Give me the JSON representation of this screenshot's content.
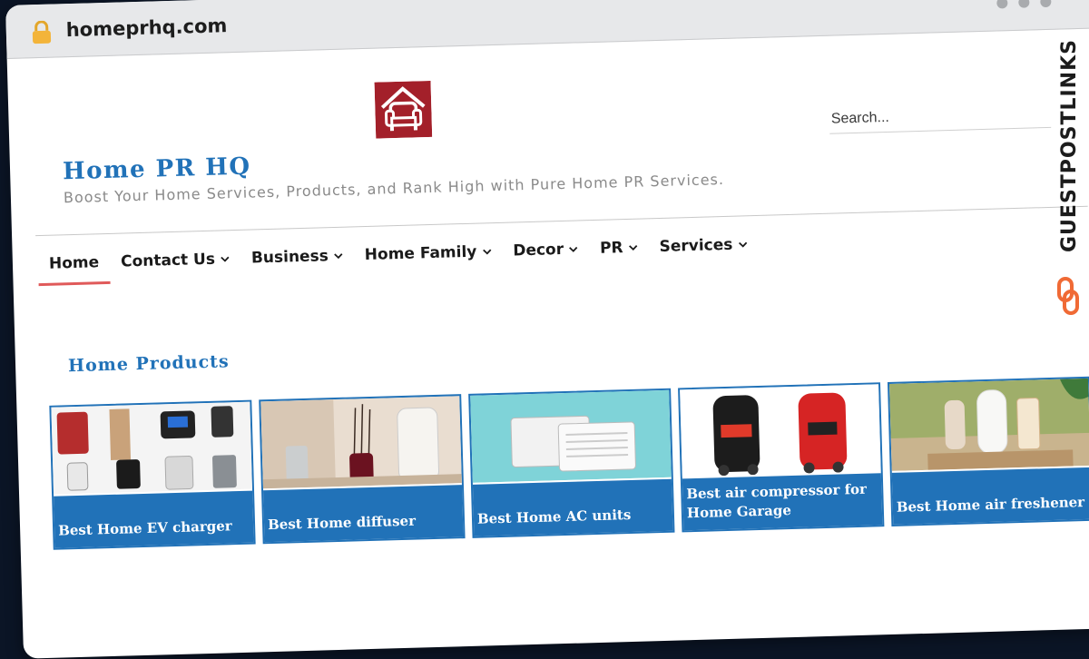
{
  "browser": {
    "url": "homeprhq.com",
    "lock_icon": "padlock-icon"
  },
  "site": {
    "title": "Home PR HQ",
    "tagline": "Boost Your Home Services, Products, and Rank High with Pure Home PR Services.",
    "logo_icon": "armchair-house-logo"
  },
  "search": {
    "placeholder": "Search..."
  },
  "nav": {
    "items": [
      {
        "label": "Home",
        "active": true,
        "dropdown": false
      },
      {
        "label": "Contact Us",
        "dropdown": true
      },
      {
        "label": "Business",
        "dropdown": true
      },
      {
        "label": "Home Family",
        "dropdown": true
      },
      {
        "label": "Decor",
        "dropdown": true
      },
      {
        "label": "PR",
        "dropdown": true
      },
      {
        "label": "Services",
        "dropdown": true
      }
    ]
  },
  "section": {
    "title": "Home Products"
  },
  "cards": [
    {
      "title": "Best Home EV charger",
      "image": "ev-chargers-photo"
    },
    {
      "title": "Best Home diffuser",
      "image": "diffuser-photo"
    },
    {
      "title": "Best Home AC units",
      "image": "ac-units-photo"
    },
    {
      "title": "Best air compressor for Home Garage",
      "image": "air-compressor-photo"
    },
    {
      "title": "Best Home air freshener",
      "image": "air-freshener-photo"
    }
  ],
  "watermark": {
    "text": "GUESTPOSTLINKS"
  },
  "colors": {
    "brand_blue": "#2172b8",
    "active_underline": "#e05a5a",
    "logo_red": "#a3202a",
    "watermark_accent": "#f06a35"
  }
}
